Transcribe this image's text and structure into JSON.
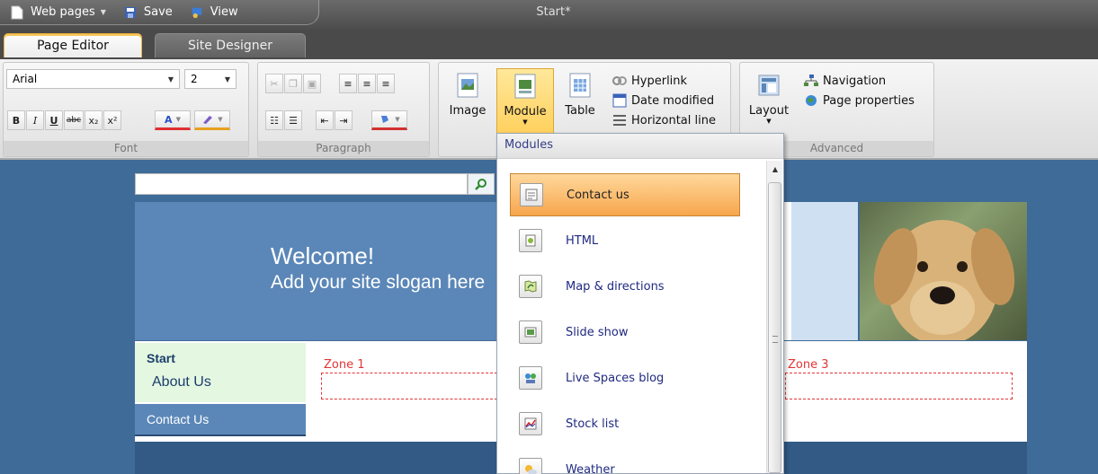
{
  "window": {
    "title": "Start*"
  },
  "quick_access": {
    "web_pages": "Web pages",
    "save": "Save",
    "view": "View"
  },
  "tabs": [
    {
      "label": "Page Editor",
      "active": true
    },
    {
      "label": "Site Designer",
      "active": false
    }
  ],
  "ribbon": {
    "font": {
      "label": "Font",
      "family": "Arial",
      "size": "2",
      "bold": "B",
      "italic": "I",
      "underline": "U",
      "strike": "abc",
      "subscript": "x₂",
      "superscript": "x²",
      "font_color": "A"
    },
    "paragraph": {
      "label": "Paragraph"
    },
    "insert": {
      "image": "Image",
      "module": "Module",
      "table": "Table",
      "hyperlink": "Hyperlink",
      "date_modified": "Date modified",
      "horizontal_line": "Horizontal line"
    },
    "advanced": {
      "label": "Advanced",
      "layout": "Layout",
      "navigation": "Navigation",
      "page_properties": "Page properties"
    }
  },
  "page": {
    "welcome": "Welcome!",
    "slogan": "Add your site slogan here",
    "nav": {
      "start": "Start",
      "about": "About Us",
      "contact": "Contact Us"
    },
    "zones": {
      "zone1": "Zone 1",
      "zone3": "Zone 3"
    }
  },
  "modules_menu": {
    "header": "Modules",
    "items": [
      {
        "label": "Contact us",
        "icon": "contact-form-icon",
        "selected": true
      },
      {
        "label": "HTML",
        "icon": "html-icon"
      },
      {
        "label": "Map & directions",
        "icon": "map-icon"
      },
      {
        "label": "Slide show",
        "icon": "slideshow-icon"
      },
      {
        "label": "Live Spaces blog",
        "icon": "blog-icon"
      },
      {
        "label": "Stock list",
        "icon": "stock-chart-icon"
      },
      {
        "label": "Weather",
        "icon": "weather-icon"
      }
    ]
  },
  "colors": {
    "accent_orange": "#f7a64c",
    "page_bg": "#3f6b99",
    "zone_red": "#e23535",
    "menu_text": "#202a80"
  }
}
